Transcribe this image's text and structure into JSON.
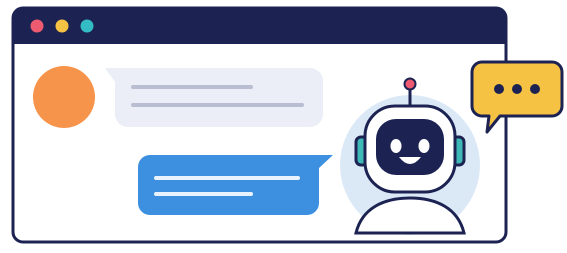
{
  "window": {
    "title_bar_color": "#1c2352",
    "traffic_lights": [
      {
        "name": "close",
        "color": "#ee5a6f"
      },
      {
        "name": "minimize",
        "color": "#f6c244"
      },
      {
        "name": "zoom",
        "color": "#34bcc4"
      }
    ]
  },
  "conversation": {
    "user_avatar_color": "#f7944b",
    "incoming_bubble_color": "#eceef7",
    "outgoing_bubble_color": "#3d8fe0",
    "placeholder_line_color_incoming": "#b8bdd2",
    "placeholder_line_color_outgoing": "#e9f3ff"
  },
  "assistant": {
    "icon": "robot-icon",
    "circle_color": "#dbe9f7",
    "head_color": "#ffffff",
    "visor_color": "#1c2352",
    "face_color": "#ffffff",
    "ear_color": "#3fb8b8",
    "antenna_tip_color": "#ee5a6f",
    "typing_bubble": {
      "icon": "typing-dots-icon",
      "color": "#f6c244",
      "dot_color": "#1c2352"
    }
  }
}
